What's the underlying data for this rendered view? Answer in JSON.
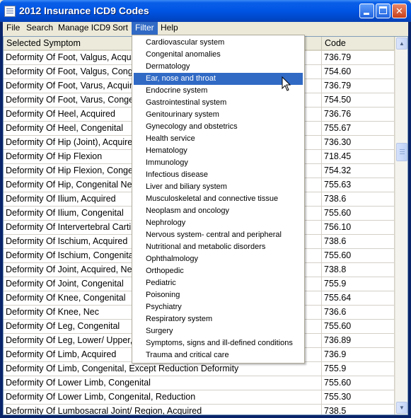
{
  "window": {
    "title": "2012 Insurance ICD9 Codes"
  },
  "menubar": {
    "items": [
      "File",
      "Search",
      "Manage ICD9",
      "Sort",
      "Filter",
      "Help"
    ],
    "active": "Filter"
  },
  "table": {
    "headers": {
      "symptom": "Selected Symptom",
      "code": "Code"
    },
    "rows": [
      {
        "symptom": "Deformity Of Foot, Valgus, Acquired",
        "code": "736.79"
      },
      {
        "symptom": "Deformity Of Foot, Valgus, Congenital",
        "code": "754.60"
      },
      {
        "symptom": "Deformity Of Foot, Varus, Acquired",
        "code": "736.79"
      },
      {
        "symptom": "Deformity Of Foot, Varus, Congenital",
        "code": "754.50"
      },
      {
        "symptom": "Deformity Of Heel, Acquired",
        "code": "736.76"
      },
      {
        "symptom": "Deformity Of Heel, Congenital",
        "code": "755.67"
      },
      {
        "symptom": "Deformity Of Hip (Joint), Acquired",
        "code": "736.30"
      },
      {
        "symptom": "Deformity Of Hip Flexion",
        "code": "718.45"
      },
      {
        "symptom": "Deformity Of Hip Flexion, Congenital",
        "code": "754.32"
      },
      {
        "symptom": "Deformity Of Hip, Congenital Nec",
        "code": "755.63"
      },
      {
        "symptom": "Deformity Of Ilium, Acquired",
        "code": "738.6"
      },
      {
        "symptom": "Deformity Of Ilium, Congenital",
        "code": "755.60"
      },
      {
        "symptom": "Deformity Of Intervertebral Cartilage",
        "code": "756.10"
      },
      {
        "symptom": "Deformity Of Ischium, Acquired",
        "code": "738.6"
      },
      {
        "symptom": "Deformity Of Ischium, Congenital",
        "code": "755.60"
      },
      {
        "symptom": "Deformity Of Joint, Acquired, Nec",
        "code": "738.8"
      },
      {
        "symptom": "Deformity Of Joint, Congenital",
        "code": "755.9"
      },
      {
        "symptom": "Deformity Of Knee, Congenital",
        "code": "755.64"
      },
      {
        "symptom": "Deformity Of Knee, Nec",
        "code": "736.6"
      },
      {
        "symptom": "Deformity Of Leg, Congenital",
        "code": "755.60"
      },
      {
        "symptom": "Deformity Of Leg, Lower/ Upper, Acquired",
        "code": "736.89"
      },
      {
        "symptom": "Deformity Of Limb, Acquired",
        "code": "736.9"
      },
      {
        "symptom": "Deformity Of Limb, Congenital, Except Reduction Deformity",
        "code": "755.9"
      },
      {
        "symptom": "Deformity Of Lower Limb, Congenital",
        "code": "755.60"
      },
      {
        "symptom": "Deformity Of Lower Limb, Congenital, Reduction",
        "code": "755.30"
      },
      {
        "symptom": "Deformity Of Lumbosacral Joint/ Region, Acquired",
        "code": "738.5"
      }
    ]
  },
  "filter_menu": {
    "items": [
      "Cardiovascular system",
      "Congenital anomalies",
      "Dermatology",
      "Ear, nose and throat",
      "Endocrine system",
      "Gastrointestinal system",
      "Genitourinary system",
      "Gynecology and obstetrics",
      "Health service",
      "Hematology",
      "Immunology",
      "Infectious disease",
      "Liver and biliary system",
      "Musculoskeletal and connective tissue",
      "Neoplasm and oncology",
      "Nephrology",
      "Nervous system- central and peripheral",
      "Nutritional and metabolic disorders",
      "Ophthalmology",
      "Orthopedic",
      "Pediatric",
      "Poisoning",
      "Psychiatry",
      "Respiratory system",
      "Surgery",
      "Symptoms, signs and ill-defined conditions",
      "Trauma and critical care"
    ],
    "highlighted": "Ear, nose and throat"
  },
  "icons": {
    "app": "document-list-icon",
    "minimize": "minimize-icon",
    "maximize": "maximize-icon",
    "close": "close-icon",
    "cursor": "mouse-pointer-icon",
    "scroll_up": "scroll-up-arrow-icon",
    "scroll_down": "scroll-down-arrow-icon"
  },
  "colors": {
    "titlebar": "#0054e3",
    "highlight": "#316ac5",
    "header_bg": "#ebeadb"
  }
}
